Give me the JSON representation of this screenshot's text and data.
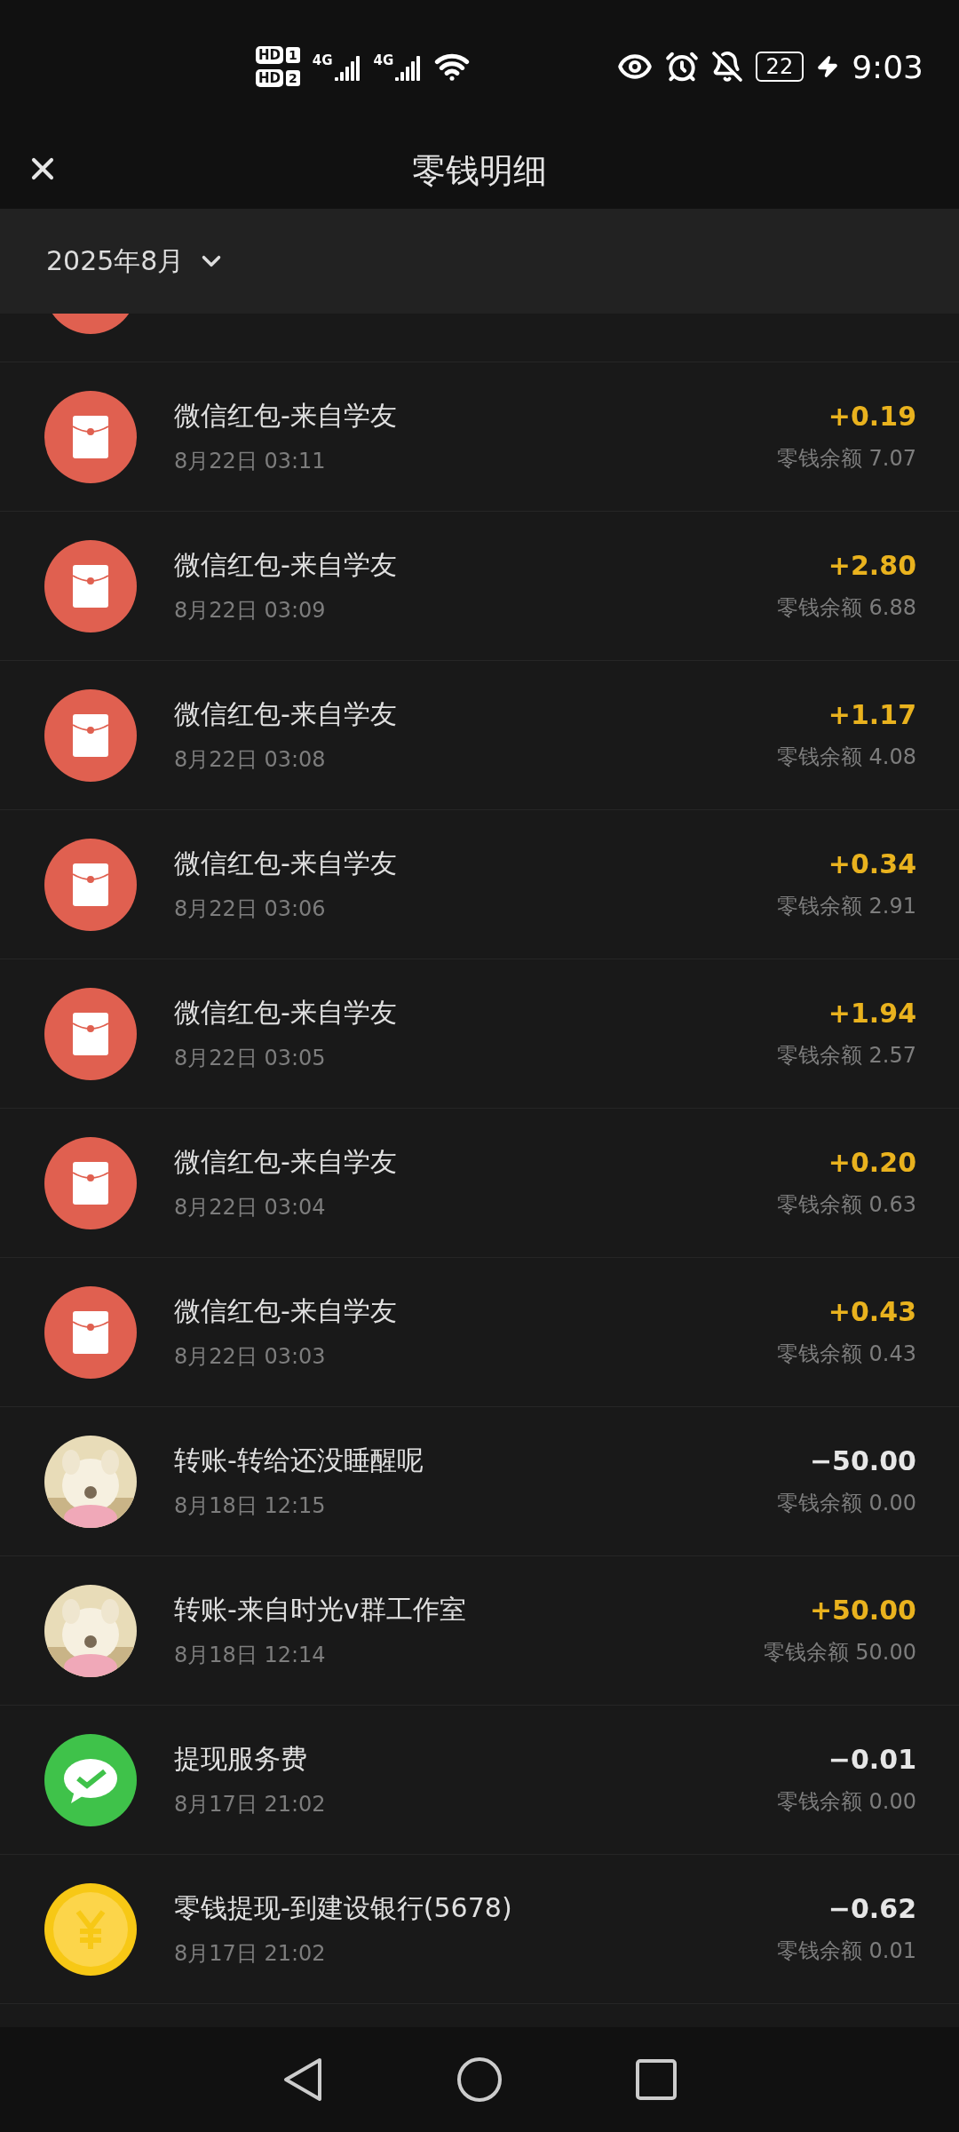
{
  "status_bar": {
    "sims": [
      {
        "label": "HD",
        "slot": "1"
      },
      {
        "label": "HD",
        "slot": "2"
      }
    ],
    "networks": [
      "4G",
      "4G"
    ],
    "battery": "22",
    "time": "9:03"
  },
  "header": {
    "title": "零钱明细"
  },
  "month_filter": {
    "label": "2025年8月"
  },
  "partial_row": {
    "kind": "redpacket"
  },
  "transactions": [
    {
      "kind": "redpacket",
      "title": "微信红包-来自学友",
      "time": "8月22日 03:11",
      "amount": "+0.19",
      "income": true,
      "balance": "零钱余额 7.07"
    },
    {
      "kind": "redpacket",
      "title": "微信红包-来自学友",
      "time": "8月22日 03:09",
      "amount": "+2.80",
      "income": true,
      "balance": "零钱余额 6.88"
    },
    {
      "kind": "redpacket",
      "title": "微信红包-来自学友",
      "time": "8月22日 03:08",
      "amount": "+1.17",
      "income": true,
      "balance": "零钱余额 4.08"
    },
    {
      "kind": "redpacket",
      "title": "微信红包-来自学友",
      "time": "8月22日 03:06",
      "amount": "+0.34",
      "income": true,
      "balance": "零钱余额 2.91"
    },
    {
      "kind": "redpacket",
      "title": "微信红包-来自学友",
      "time": "8月22日 03:05",
      "amount": "+1.94",
      "income": true,
      "balance": "零钱余额 2.57"
    },
    {
      "kind": "redpacket",
      "title": "微信红包-来自学友",
      "time": "8月22日 03:04",
      "amount": "+0.20",
      "income": true,
      "balance": "零钱余额 0.63"
    },
    {
      "kind": "redpacket",
      "title": "微信红包-来自学友",
      "time": "8月22日 03:03",
      "amount": "+0.43",
      "income": true,
      "balance": "零钱余额 0.43"
    },
    {
      "kind": "picture",
      "title": "转账-转给还没睡醒呢",
      "time": "8月18日 12:15",
      "amount": "−50.00",
      "income": false,
      "balance": "零钱余额 0.00"
    },
    {
      "kind": "picture",
      "title": "转账-来自时光v群工作室",
      "time": "8月18日 12:14",
      "amount": "+50.00",
      "income": true,
      "balance": "零钱余额 50.00"
    },
    {
      "kind": "wechat",
      "title": "提现服务费",
      "time": "8月17日 21:02",
      "amount": "−0.01",
      "income": false,
      "balance": "零钱余额 0.00"
    },
    {
      "kind": "coin",
      "title": "零钱提现-到建设银行(5678)",
      "time": "8月17日 21:02",
      "amount": "−0.62",
      "income": false,
      "balance": "零钱余额 0.01"
    }
  ]
}
